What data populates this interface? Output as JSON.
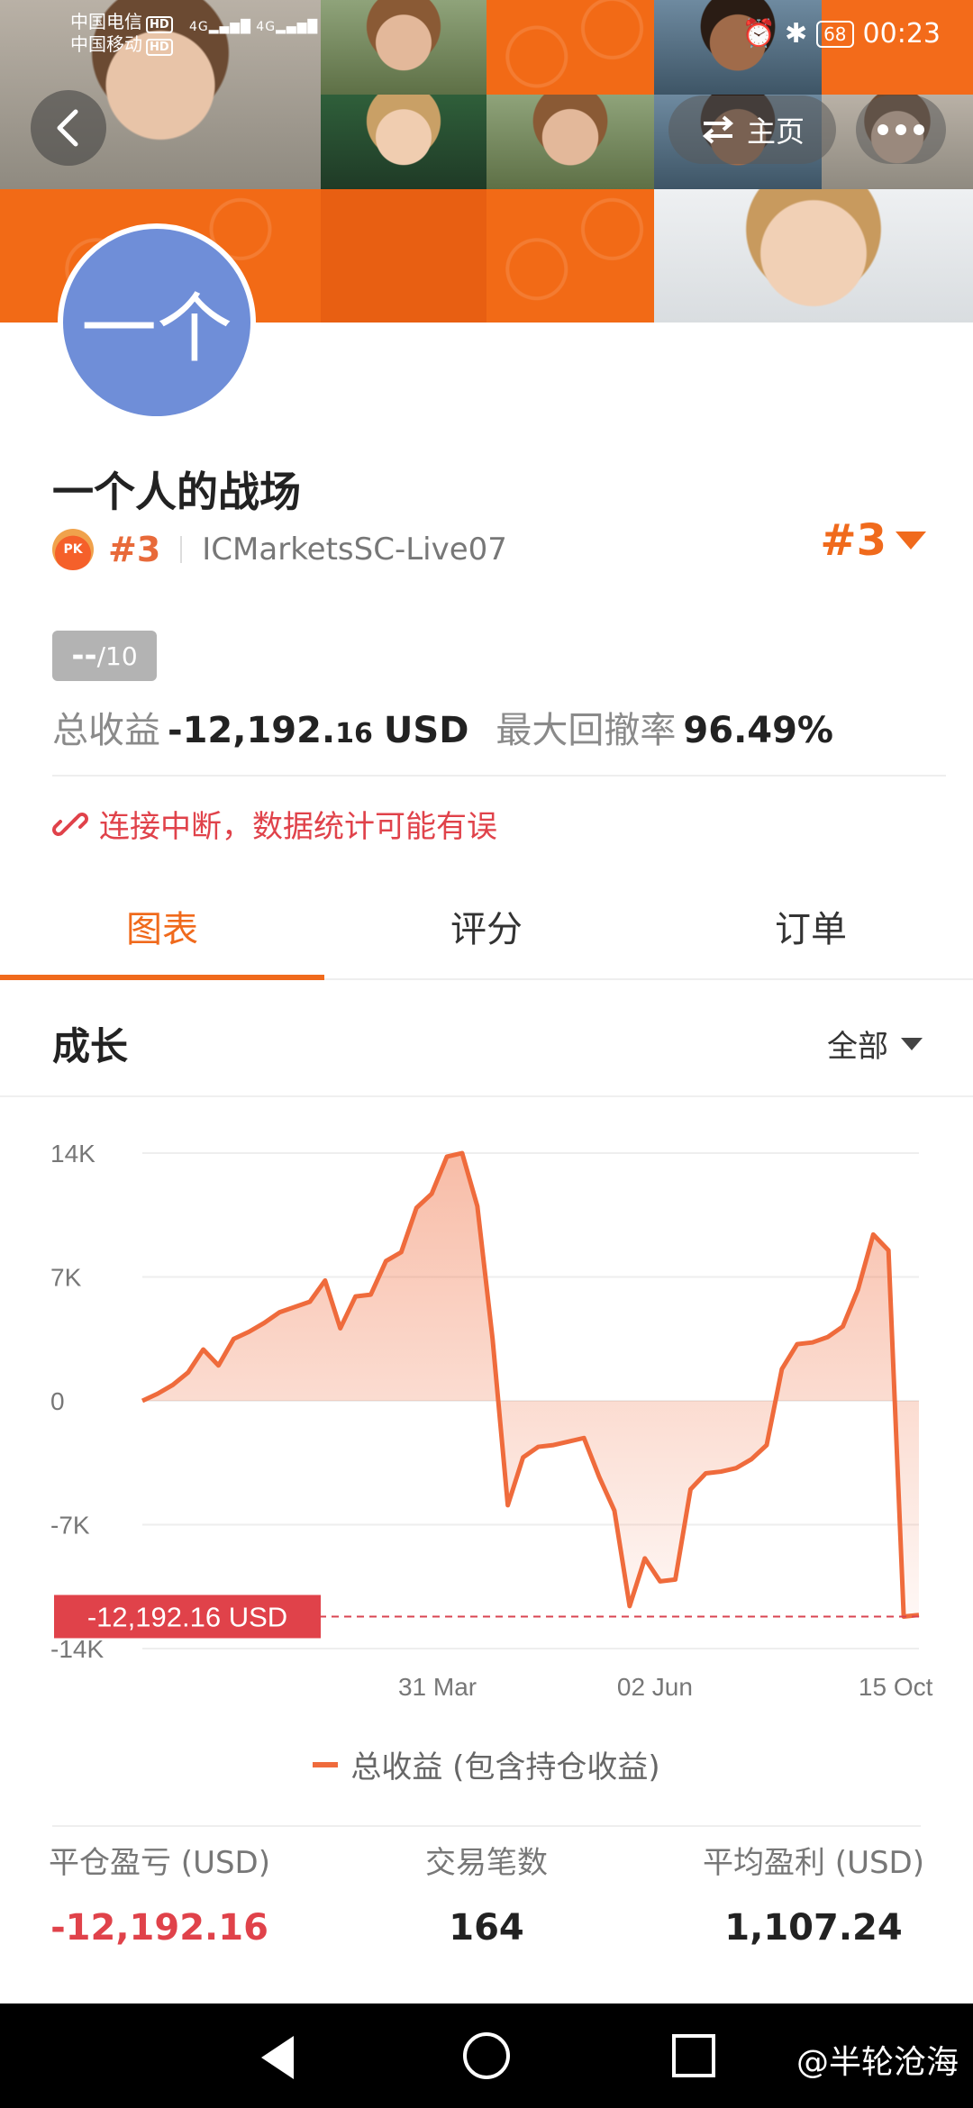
{
  "status_bar": {
    "carrier1": "中国电信",
    "carrier2": "中国移动",
    "hd": "HD",
    "net": "4G",
    "battery": "68",
    "time": "00:23"
  },
  "header": {
    "home_label": "主页"
  },
  "profile": {
    "avatar_text": "一个",
    "name": "一个人的战场",
    "rank": "#3",
    "server": "ICMarketsSC-Live07",
    "rank_dropdown": "#3",
    "score": "--",
    "score_max": "/10",
    "total_profit_label": "总收益",
    "total_profit_value": "-12,192.",
    "total_profit_decimals": "16",
    "total_profit_unit": "USD",
    "drawdown_label": "最大回撤率",
    "drawdown_value": "96.49%",
    "alert_text": "连接中断，数据统计可能有误"
  },
  "tabs": [
    {
      "label": "图表",
      "active": true
    },
    {
      "label": "评分",
      "active": false
    },
    {
      "label": "订单",
      "active": false
    }
  ],
  "section": {
    "title": "成长",
    "period": "全部"
  },
  "chart_data": {
    "type": "area",
    "y_ticks": [
      "14K",
      "7K",
      "0",
      "-7K",
      "-14K"
    ],
    "x_ticks": [
      "31 Mar",
      "02 Jun",
      "15 Oct"
    ],
    "ylim": [
      -14000,
      14000
    ],
    "current_label": "-12,192.16 USD",
    "current_value": -12192.16,
    "series": [
      {
        "name": "总收益 (包含持仓收益)",
        "color": "#ef6b3c",
        "values": [
          0,
          400,
          900,
          1600,
          2900,
          2000,
          3500,
          3900,
          4400,
          5000,
          5300,
          5600,
          6800,
          4100,
          5900,
          6000,
          7900,
          8400,
          10900,
          11700,
          13800,
          14000,
          11000,
          3500,
          -5900,
          -3200,
          -2600,
          -2500,
          -2300,
          -2100,
          -4300,
          -6200,
          -11600,
          -8900,
          -10200,
          -10100,
          -5000,
          -4100,
          -4000,
          -3800,
          -3300,
          -2500,
          1800,
          3200,
          3300,
          3600,
          4200,
          6300,
          9400,
          8500,
          -12192.16,
          -12100
        ]
      }
    ]
  },
  "legend": {
    "label": "总收益 (包含持仓收益)"
  },
  "bottom_stats": {
    "closed_pl_label": "平仓盈亏 (USD)",
    "closed_pl_value": "-12,192.16",
    "trades_label": "交易笔数",
    "trades_value": "164",
    "avg_profit_label": "平均盈利 (USD)",
    "avg_profit_value": "1,107.24"
  },
  "system_nav": {
    "watermark": "@半轮沧海"
  }
}
